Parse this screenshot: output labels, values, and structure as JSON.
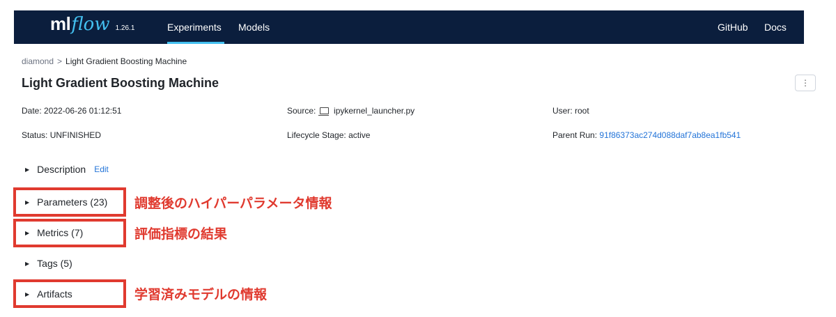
{
  "header": {
    "logo_ml": "ml",
    "logo_flow": "flow",
    "version": "1.26.1",
    "nav": [
      "Experiments",
      "Models"
    ],
    "right_links": [
      "GitHub",
      "Docs"
    ]
  },
  "breadcrumb": {
    "parent": "diamond",
    "separator": ">",
    "current": "Light Gradient Boosting Machine"
  },
  "title": "Light Gradient Boosting Machine",
  "more_button": "⋮",
  "meta": {
    "date_label": "Date:",
    "date_value": "2022-06-26 01:12:51",
    "source_label": "Source:",
    "source_value": "ipykernel_launcher.py",
    "user_label": "User:",
    "user_value": "root",
    "status_label": "Status:",
    "status_value": "UNFINISHED",
    "lifecycle_label": "Lifecycle Stage:",
    "lifecycle_value": "active",
    "parent_run_label": "Parent Run:",
    "parent_run_value": "91f86373ac274d088daf7ab8ea1fb541"
  },
  "sections": {
    "description": "Description",
    "edit": "Edit",
    "parameters": "Parameters (23)",
    "metrics": "Metrics (7)",
    "tags": "Tags (5)",
    "artifacts": "Artifacts"
  },
  "annotations": {
    "parameters": "調整後のハイパーパラメータ情報",
    "metrics": "評価指標の結果",
    "artifacts": "学習済みモデルの情報"
  },
  "colors": {
    "header_bg": "#0b1e3d",
    "accent": "#43c0f0",
    "link": "#2374d8",
    "annotation_red": "#e03a2f"
  }
}
